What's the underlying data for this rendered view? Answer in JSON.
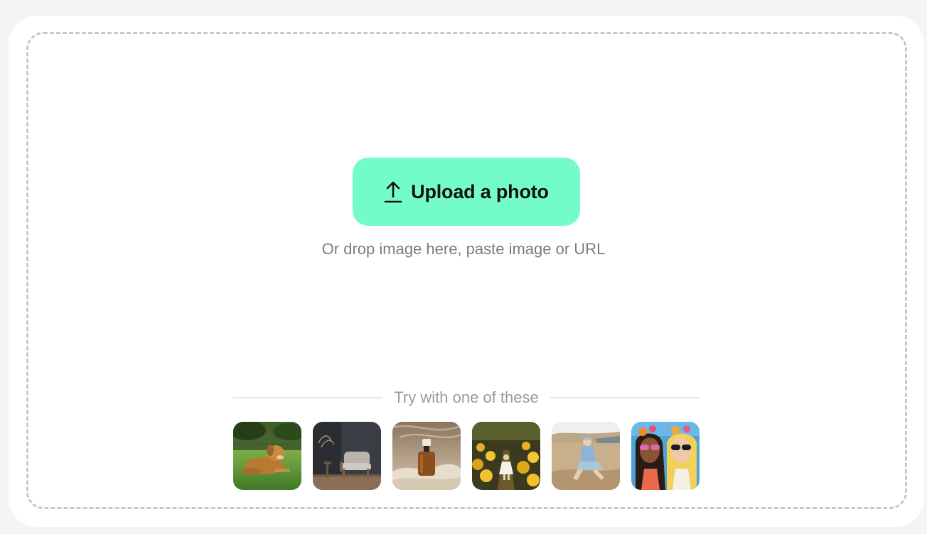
{
  "upload": {
    "label": "Upload a photo",
    "icon": "upload-arrow-icon",
    "bg_color": "#74fcc8"
  },
  "hint": "Or drop image here, paste image or URL",
  "samples": {
    "heading": "Try with one of these",
    "items": [
      {
        "subject": "golden retriever lying on grass"
      },
      {
        "subject": "lounge chair in dark room"
      },
      {
        "subject": "amber dropper bottle on sand"
      },
      {
        "subject": "little girl in yellow flower field"
      },
      {
        "subject": "woman in cap sitting on sand"
      },
      {
        "subject": "illustrated women in sunglasses with flowers"
      }
    ]
  }
}
